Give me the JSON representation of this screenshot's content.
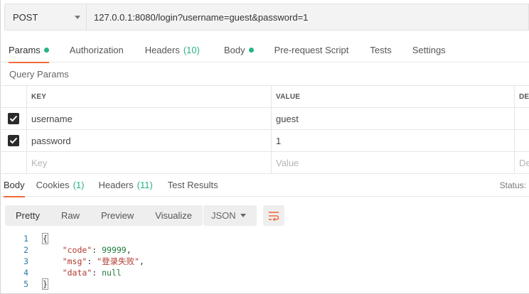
{
  "request": {
    "method": "POST",
    "url": "127.0.0.1:8080/login?username=guest&password=1"
  },
  "request_tabs": [
    {
      "label": "Params",
      "dot": true
    },
    {
      "label": "Authorization"
    },
    {
      "label": "Headers",
      "count": "(10)"
    },
    {
      "label": "Body",
      "dot": true
    },
    {
      "label": "Pre-request Script"
    },
    {
      "label": "Tests"
    },
    {
      "label": "Settings"
    }
  ],
  "query_params": {
    "title": "Query Params",
    "headers": {
      "key": "KEY",
      "value": "VALUE",
      "desc": "DE"
    },
    "rows": [
      {
        "key": "username",
        "value": "guest",
        "checked": true
      },
      {
        "key": "password",
        "value": "1",
        "checked": true
      }
    ],
    "placeholder": {
      "key": "Key",
      "value": "Value",
      "desc": "De"
    }
  },
  "response_tabs": [
    {
      "label": "Body"
    },
    {
      "label": "Cookies",
      "count": "(1)"
    },
    {
      "label": "Headers",
      "count": "(11)"
    },
    {
      "label": "Test Results"
    }
  ],
  "status_label": "Status:",
  "view_modes": [
    "Pretty",
    "Raw",
    "Preview",
    "Visualize"
  ],
  "format": "JSON",
  "code_lines": [
    {
      "n": "1",
      "parts": [
        [
          "p",
          "{"
        ]
      ]
    },
    {
      "n": "2",
      "parts": [
        [
          "p",
          "    "
        ],
        [
          "k",
          "\"code\""
        ],
        [
          "p",
          ": "
        ],
        [
          "n",
          "99999"
        ],
        [
          "p",
          ","
        ]
      ]
    },
    {
      "n": "3",
      "parts": [
        [
          "p",
          "    "
        ],
        [
          "k",
          "\"msg\""
        ],
        [
          "p",
          ": "
        ],
        [
          "s",
          "\"登录失败\""
        ],
        [
          "p",
          ","
        ]
      ]
    },
    {
      "n": "4",
      "parts": [
        [
          "p",
          "    "
        ],
        [
          "k",
          "\"data\""
        ],
        [
          "p",
          ": "
        ],
        [
          "n",
          "null"
        ]
      ]
    },
    {
      "n": "5",
      "parts": [
        [
          "p",
          "}"
        ]
      ]
    }
  ],
  "colors": {
    "accent": "#f26b3a",
    "green": "#26b47f"
  }
}
